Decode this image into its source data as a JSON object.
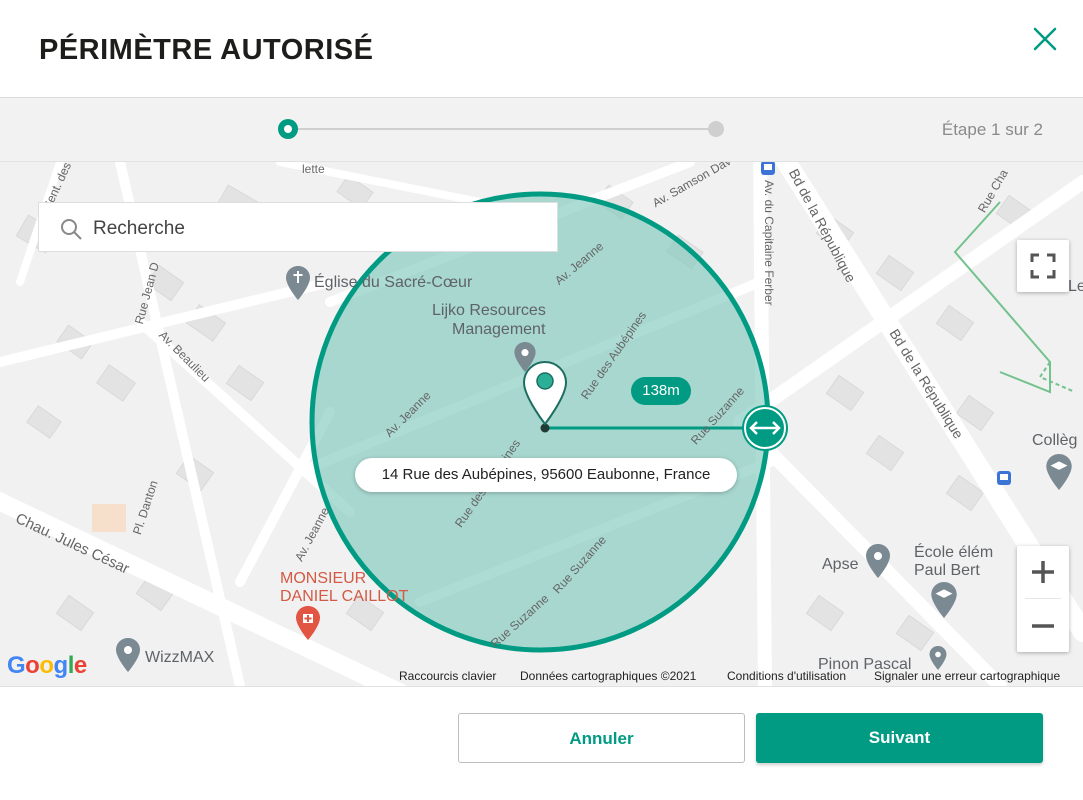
{
  "dialog": {
    "title": "PÉRIMÈTRE AUTORISÉ",
    "close_icon": "close-icon"
  },
  "stepper": {
    "current_step": 1,
    "total_steps": 2,
    "text": "Étape 1 sur 2"
  },
  "map": {
    "search": {
      "placeholder": "Recherche",
      "icon": "search-icon"
    },
    "radius_label": "138m",
    "address": "14 Rue des Aubépines, 95600 Eaubonne, France",
    "pois": {
      "church": "Église du Sacré-Cœur",
      "lijko_line1": "Lijko Resources",
      "lijko_line2": "Management",
      "monsieur_line1": "MONSIEUR",
      "monsieur_line2": "DANIEL CAILLOT",
      "wizzmax": "WizzMAX",
      "apse": "Apse",
      "ecole_line1": "École élém",
      "ecole_line2": "Paul Bert",
      "college": "Collèg",
      "pinon": "Pinon Pascal",
      "les": "Les"
    },
    "roads": {
      "av_jeanne_1": "Av. Jeanne",
      "av_jeanne_2": "Av. Jeanne",
      "av_jeanne_3": "Av. Jeanne",
      "rue_aubepines_1": "Rue des Aubépines",
      "rue_aubepines_2": "Rue des Aubépines",
      "rue_suzanne_1": "Rue Suzanne",
      "rue_suzanne_2": "Rue Suzanne",
      "rue_suzanne_3": "Rue Suzanne",
      "bd_republique_1": "Bd de la République",
      "bd_republique_2": "Bd de la République",
      "av_capitaine": "Av. du Capitaine Ferber",
      "av_samson": "Av. Samson Dav",
      "av_beaulieu": "Av. Beaulieu",
      "rue_jean": "Rue Jean D",
      "chau_jules": "Chau. Jules César",
      "pl_danton": "Pl. Danton",
      "rue_cha": "Rue Cha",
      "sent_des": "Sent. des I",
      "lette": "lette"
    },
    "controls": {
      "fullscreen_icon": "fullscreen-icon",
      "zoom_in_icon": "plus-icon",
      "zoom_out_icon": "minus-icon"
    },
    "attribution": {
      "logo": "Google",
      "shortcuts": "Raccourcis clavier",
      "data": "Données cartographiques ©2021",
      "terms": "Conditions d'utilisation",
      "report": "Signaler une erreur cartographique"
    }
  },
  "footer": {
    "cancel_label": "Annuler",
    "next_label": "Suivant"
  },
  "colors": {
    "accent": "#009b82",
    "circle_fill": "#7fcabd",
    "map_bg": "#f1f1f1",
    "poi_red": "#e25542"
  }
}
